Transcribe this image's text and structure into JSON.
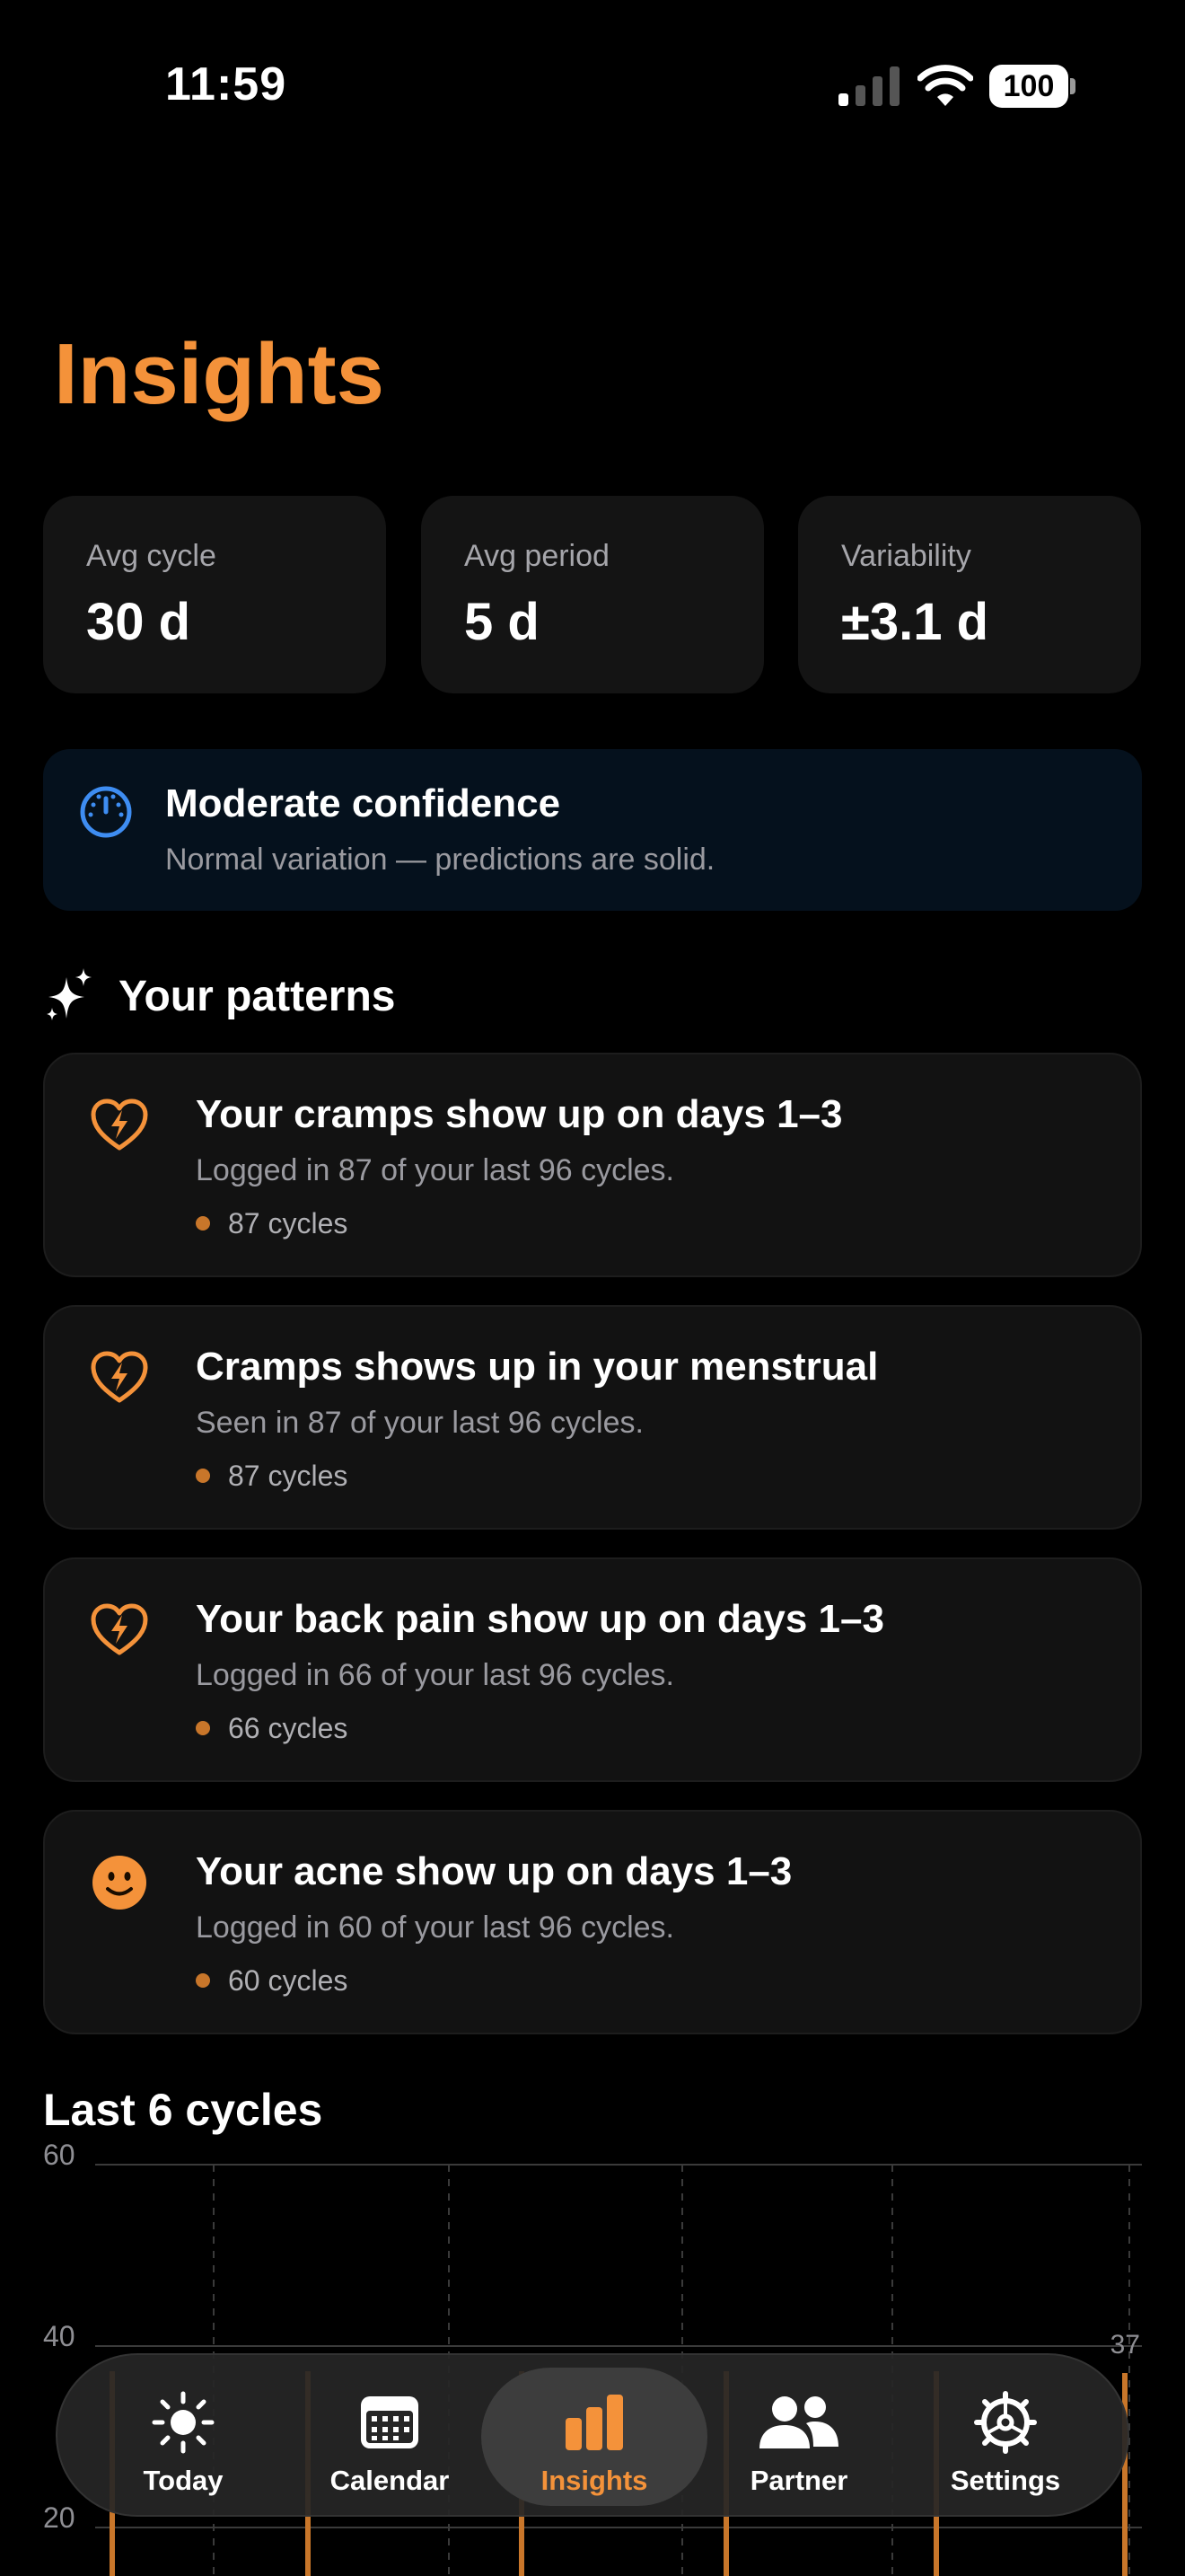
{
  "status_bar": {
    "time": "11:59",
    "battery": "100",
    "icons": [
      "cellular-signal-icon",
      "wifi-icon",
      "battery-icon"
    ]
  },
  "page": {
    "title": "Insights"
  },
  "stats": [
    {
      "label": "Avg cycle",
      "value": "30 d"
    },
    {
      "label": "Avg period",
      "value": "5 d"
    },
    {
      "label": "Variability",
      "value": "±3.1 d"
    }
  ],
  "confidence": {
    "icon": "gauge-icon",
    "title": "Moderate confidence",
    "subtitle": "Normal variation — predictions are solid."
  },
  "patterns": {
    "icon": "sparkles-icon",
    "title": "Your patterns",
    "items": [
      {
        "icon": "heart-bolt-icon",
        "title": "Your cramps show up on days 1–3",
        "subtitle": "Logged in 87 of your last 96 cycles.",
        "badge": "87 cycles"
      },
      {
        "icon": "heart-bolt-icon",
        "title": "Cramps shows up in your menstrual",
        "subtitle": "Seen in 87 of your last 96 cycles.",
        "badge": "87 cycles"
      },
      {
        "icon": "heart-bolt-icon",
        "title": "Your back pain show up on days 1–3",
        "subtitle": "Logged in 66 of your last 96 cycles.",
        "badge": "66 cycles"
      },
      {
        "icon": "smiley-face-icon",
        "title": "Your acne show up on days 1–3",
        "subtitle": "Logged in 60 of your last 96 cycles.",
        "badge": "60 cycles"
      }
    ]
  },
  "chart_section": {
    "title": "Last 6 cycles"
  },
  "chart_data": {
    "type": "bar",
    "y_ticks": [
      "60",
      "40",
      "20"
    ],
    "ylim": [
      20,
      60
    ],
    "grid": true,
    "visible_value_labels": [
      "37"
    ],
    "colors": {
      "bar": "#C8762A"
    }
  },
  "tab_bar": {
    "active": "Insights",
    "tabs": [
      {
        "label": "Today",
        "icon": "sun-icon"
      },
      {
        "label": "Calendar",
        "icon": "calendar-icon"
      },
      {
        "label": "Insights",
        "icon": "bar-chart-icon"
      },
      {
        "label": "Partner",
        "icon": "people-icon"
      },
      {
        "label": "Settings",
        "icon": "gear-icon"
      }
    ]
  },
  "colors": {
    "accent": "#F4923A",
    "confidence_icon": "#3E8DF2",
    "card_background": "#141414",
    "confidence_background": "#05111D"
  }
}
